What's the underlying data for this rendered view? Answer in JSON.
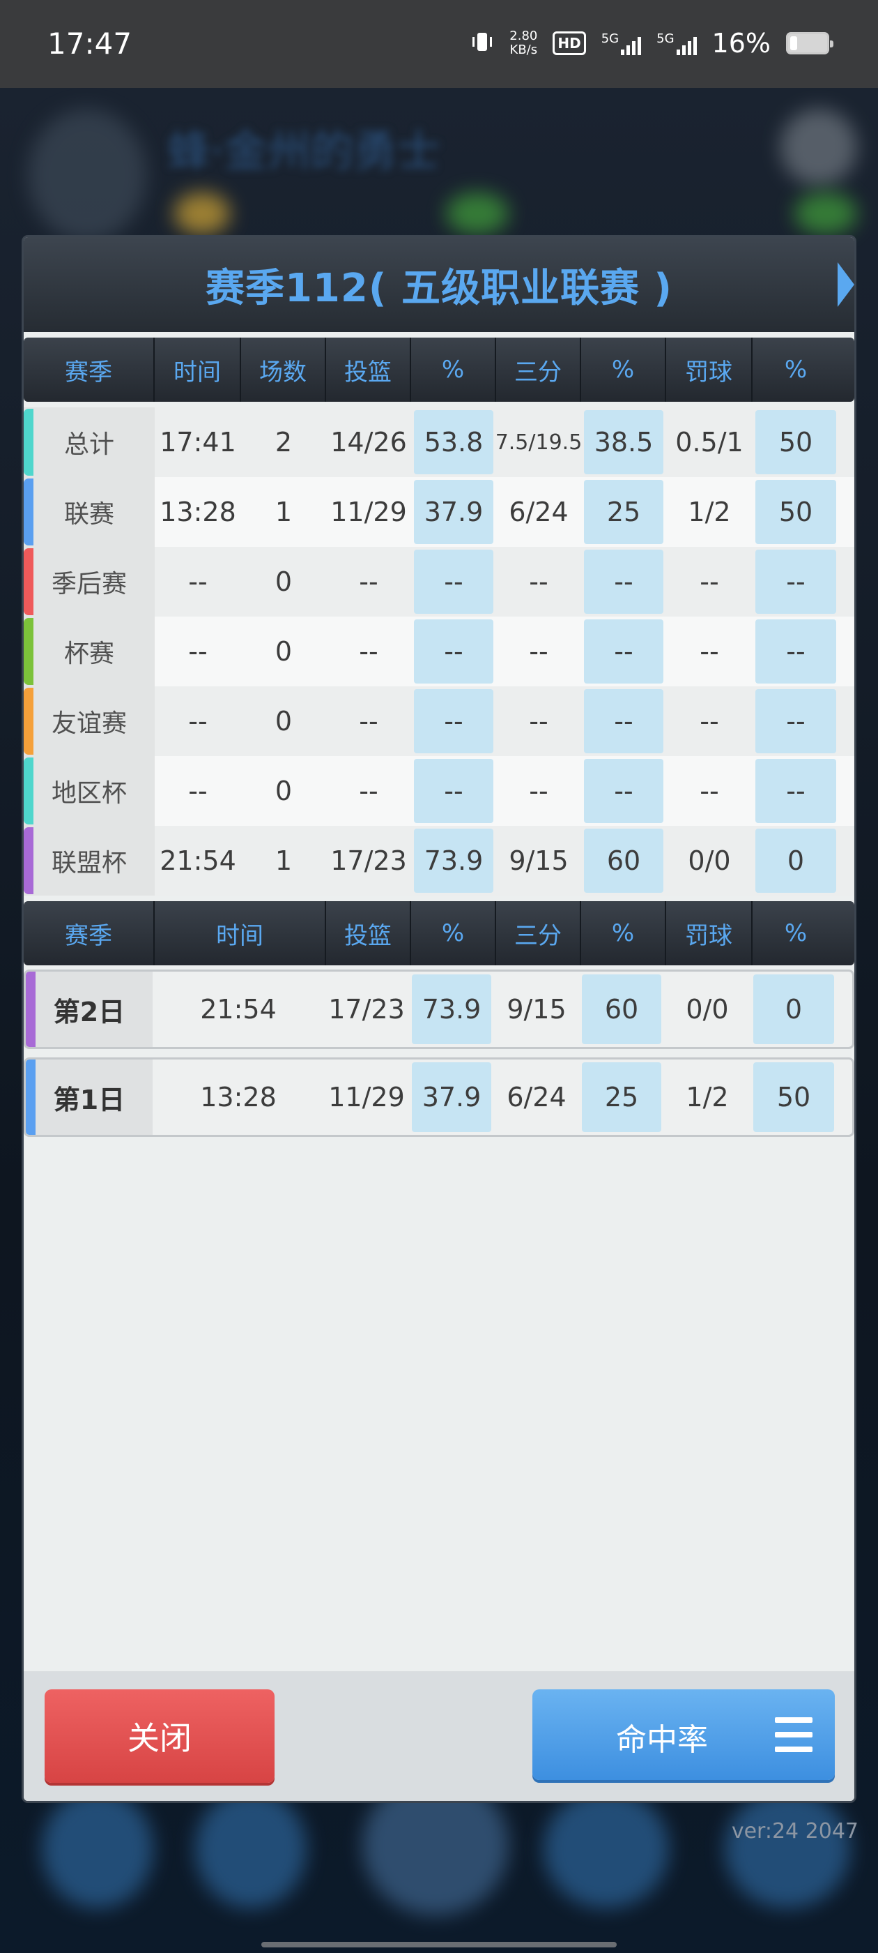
{
  "status_bar": {
    "time": "17:47",
    "net_speed_value": "2.80",
    "net_speed_unit": "KB/s",
    "hd_label": "HD",
    "sim1_label": "5G",
    "sim2_label": "5G",
    "battery_pct": "16%"
  },
  "background": {
    "team_title": "蜂·金州的勇士",
    "version": "ver:24  2047"
  },
  "dialog": {
    "title": "赛季112( 五级职业联赛 )",
    "table1": {
      "headers": [
        "赛季",
        "时间",
        "场数",
        "投篮",
        "%",
        "三分",
        "%",
        "罚球",
        "%"
      ],
      "rows": [
        {
          "label": "总计",
          "color": "#4fd6cc",
          "time": "17:41",
          "games": "2",
          "fg": "14/26",
          "fg_pct": "53.8",
          "three": "7.5/19.5",
          "three_pct": "38.5",
          "ft": "0.5/1",
          "ft_pct": "50"
        },
        {
          "label": "联赛",
          "color": "#5a9ff0",
          "time": "13:28",
          "games": "1",
          "fg": "11/29",
          "fg_pct": "37.9",
          "three": "6/24",
          "three_pct": "25",
          "ft": "1/2",
          "ft_pct": "50"
        },
        {
          "label": "季后赛",
          "color": "#ef5a5a",
          "time": "--",
          "games": "0",
          "fg": "--",
          "fg_pct": "--",
          "three": "--",
          "three_pct": "--",
          "ft": "--",
          "ft_pct": "--"
        },
        {
          "label": "杯赛",
          "color": "#7cc23a",
          "time": "--",
          "games": "0",
          "fg": "--",
          "fg_pct": "--",
          "three": "--",
          "three_pct": "--",
          "ft": "--",
          "ft_pct": "--"
        },
        {
          "label": "友谊赛",
          "color": "#f5a03a",
          "time": "--",
          "games": "0",
          "fg": "--",
          "fg_pct": "--",
          "three": "--",
          "three_pct": "--",
          "ft": "--",
          "ft_pct": "--"
        },
        {
          "label": "地区杯",
          "color": "#4fd6cc",
          "time": "--",
          "games": "0",
          "fg": "--",
          "fg_pct": "--",
          "three": "--",
          "three_pct": "--",
          "ft": "--",
          "ft_pct": "--"
        },
        {
          "label": "联盟杯",
          "color": "#a86ad6",
          "time": "21:54",
          "games": "1",
          "fg": "17/23",
          "fg_pct": "73.9",
          "three": "9/15",
          "three_pct": "60",
          "ft": "0/0",
          "ft_pct": "0"
        }
      ]
    },
    "table2": {
      "headers": [
        "赛季",
        "时间",
        "投篮",
        "%",
        "三分",
        "%",
        "罚球",
        "%"
      ],
      "rows": [
        {
          "label": "第2日",
          "color": "#a86ad6",
          "time": "21:54",
          "fg": "17/23",
          "fg_pct": "73.9",
          "three": "9/15",
          "three_pct": "60",
          "ft": "0/0",
          "ft_pct": "0"
        },
        {
          "label": "第1日",
          "color": "#5a9ff0",
          "time": "13:28",
          "fg": "11/29",
          "fg_pct": "37.9",
          "three": "6/24",
          "three_pct": "25",
          "ft": "1/2",
          "ft_pct": "50"
        }
      ]
    },
    "close_label": "关闭",
    "mode_label": "命中率"
  }
}
